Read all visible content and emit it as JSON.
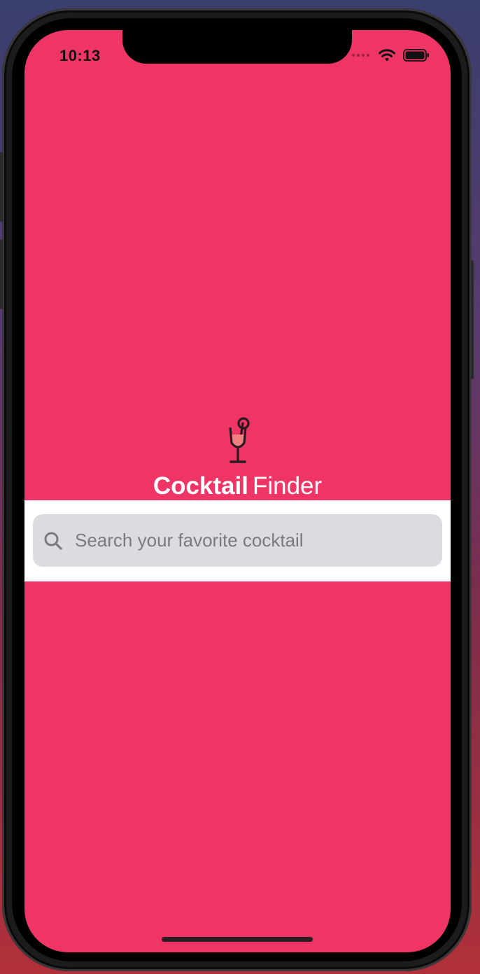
{
  "status_bar": {
    "time": "10:13",
    "icons": [
      "signal-dots-icon",
      "wifi-icon",
      "battery-icon"
    ]
  },
  "app": {
    "logo_icon": "cocktail-glass-icon",
    "title_bold": "Cocktail",
    "title_light": "Finder"
  },
  "search": {
    "icon": "search-icon",
    "placeholder": "Search your favorite cocktail",
    "value": ""
  },
  "colors": {
    "background": "#ee3566",
    "search_band": "#ffffff",
    "search_field": "#dcdbe0",
    "text": "#ffffff"
  }
}
